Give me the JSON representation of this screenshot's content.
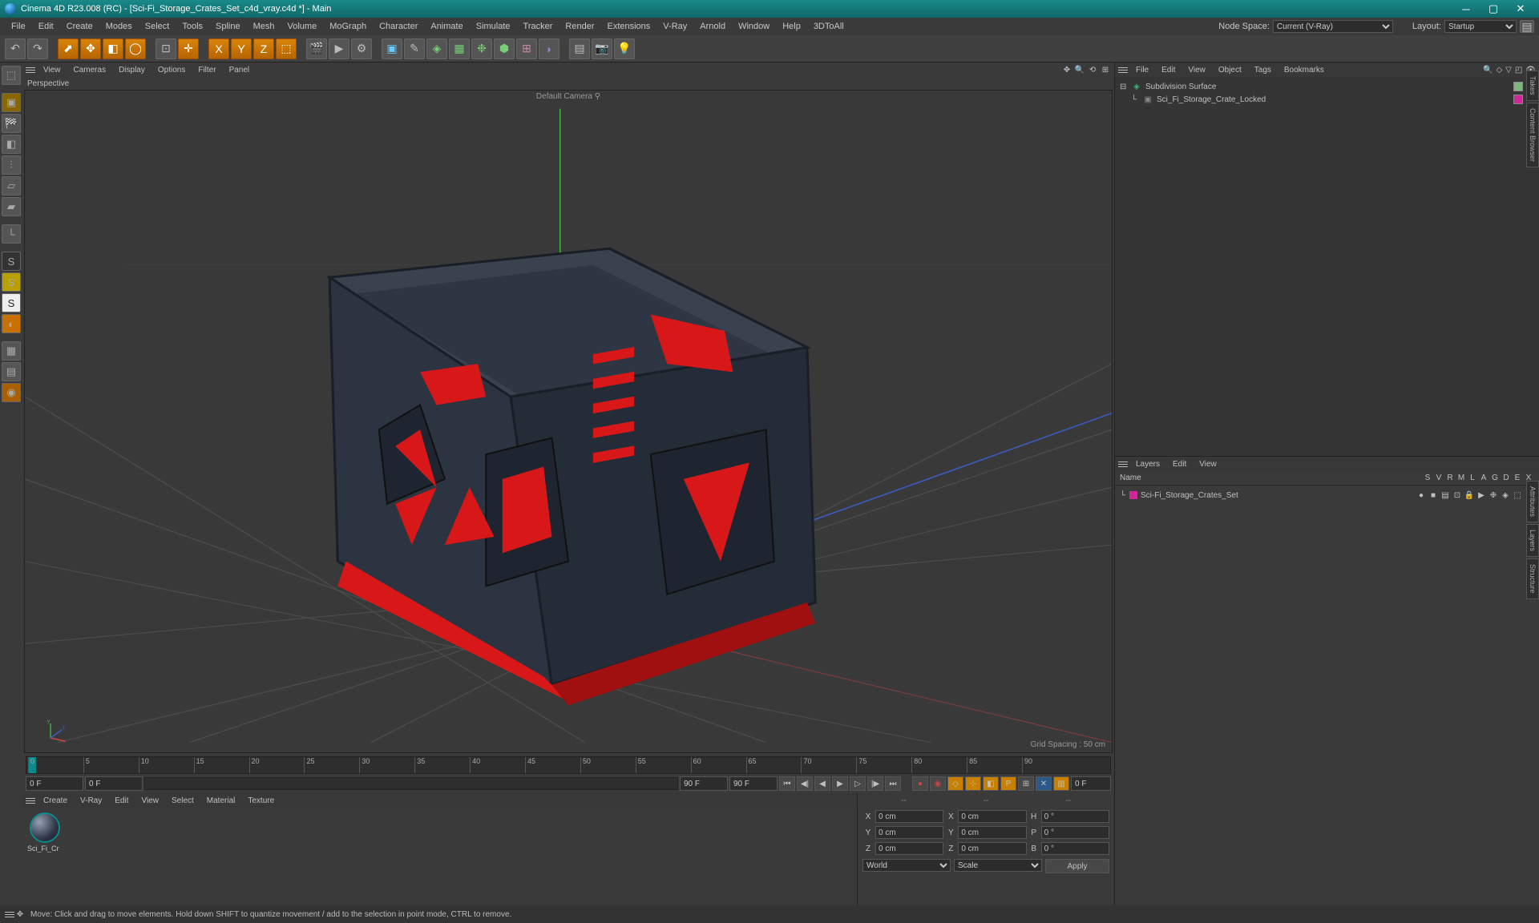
{
  "title": "Cinema 4D R23.008 (RC) - [Sci-Fi_Storage_Crates_Set_c4d_vray.c4d *] - Main",
  "menus": [
    "File",
    "Edit",
    "Create",
    "Modes",
    "Select",
    "Tools",
    "Spline",
    "Mesh",
    "Volume",
    "MoGraph",
    "Character",
    "Animate",
    "Simulate",
    "Tracker",
    "Render",
    "Extensions",
    "V-Ray",
    "Arnold",
    "Window",
    "Help",
    "3DToAll"
  ],
  "node_space_label": "Node Space:",
  "node_space_value": "Current (V-Ray)",
  "layout_label": "Layout:",
  "layout_value": "Startup",
  "viewport_menus": [
    "View",
    "Cameras",
    "Display",
    "Options",
    "Filter",
    "Panel"
  ],
  "viewport_label": "Perspective",
  "viewport_camera": "Default Camera",
  "grid_spacing": "Grid Spacing : 50 cm",
  "timeline": {
    "ticks": [
      0,
      5,
      10,
      15,
      20,
      25,
      30,
      35,
      40,
      45,
      50,
      55,
      60,
      65,
      70,
      75,
      80,
      85,
      90
    ],
    "start_f": "0 F",
    "cur_f": "0 F",
    "end_f": "90 F",
    "end_f2": "90 F",
    "right_f": "0 F"
  },
  "material_menus": [
    "Create",
    "V-Ray",
    "Edit",
    "View",
    "Select",
    "Material",
    "Texture"
  ],
  "material_name": "Sci_Fi_Cr",
  "coord": {
    "header": [
      "--",
      "--",
      "--"
    ],
    "rows": [
      {
        "axis": "X",
        "p": "0 cm",
        "s": "X",
        "sv": "0 cm",
        "r": "H",
        "rv": "0 °"
      },
      {
        "axis": "Y",
        "p": "0 cm",
        "s": "Y",
        "sv": "0 cm",
        "r": "P",
        "rv": "0 °"
      },
      {
        "axis": "Z",
        "p": "0 cm",
        "s": "Z",
        "sv": "0 cm",
        "r": "B",
        "rv": "0 °"
      }
    ],
    "world": "World",
    "scale": "Scale",
    "apply": "Apply"
  },
  "obj_menus": [
    "File",
    "Edit",
    "View",
    "Object",
    "Tags",
    "Bookmarks"
  ],
  "objects": [
    {
      "name": "Subdivision Surface",
      "indent": 0,
      "icon": "subdiv",
      "tag": "#7fb67f"
    },
    {
      "name": "Sci_Fi_Storage_Crate_Locked",
      "indent": 1,
      "icon": "poly",
      "tag": "#d02898"
    }
  ],
  "layer_menus": [
    "Layers",
    "Edit",
    "View"
  ],
  "layer_header_name": "Name",
  "layer_cols": [
    "S",
    "V",
    "R",
    "M",
    "L",
    "A",
    "G",
    "D",
    "E",
    "X"
  ],
  "layer_name": "Sci-Fi_Storage_Crates_Set",
  "vtabs_top": [
    "Takes",
    "Content Browser"
  ],
  "vtabs_bot": [
    "Attributes",
    "Layers",
    "Structure"
  ],
  "status": "Move: Click and drag to move elements. Hold down SHIFT to quantize movement / add to the selection in point mode, CTRL to remove."
}
